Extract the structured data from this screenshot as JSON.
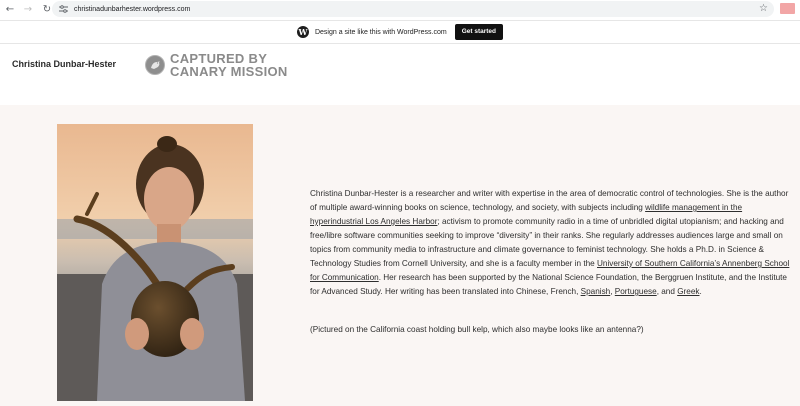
{
  "browser": {
    "url": "christinadunbarhester.wordpress.com",
    "back_icon": "arrow-left-icon",
    "forward_icon": "arrow-right-icon",
    "reload_icon": "reload-icon",
    "bookmark_icon": "star-icon"
  },
  "wp_banner": {
    "text": "Design a site like this with WordPress.com",
    "button_label": "Get started"
  },
  "header": {
    "site_title": "Christina Dunbar-Hester",
    "watermark_line1": "CAPTURED BY",
    "watermark_line2": "CANARY MISSION"
  },
  "bio": {
    "p1": "Christina Dunbar-Hester is a researcher and writer with expertise in the area of democratic control of technologies. She is the author of multiple award-winning books on science, technology, and society, with subjects including ",
    "link1": "wildlife management in the hyperindustrial Los Angeles Harbor",
    "p2": "; activism to promote community radio in a time of unbridled digital utopianism; and hacking and free/libre software communities seeking to improve “diversity” in their ranks. She regularly addresses audiences large and small on topics from community media to infrastructure and climate governance to feminist technology. She holds a Ph.D. in Science & Technology Studies from Cornell University, and she is a faculty member in the ",
    "link2": "University of Southern California’s Annenberg School for Communication",
    "p3": ". Her research has been supported by the National Science Foundation, the Berggruen Institute, and the Institute for Advanced Study. Her writing has been translated into Chinese, French, ",
    "link3": "Spanish",
    "sep1": ", ",
    "link4": "Portuguese",
    "sep2": ", and ",
    "link5": "Greek",
    "end": ".",
    "caption": "(Pictured on the California coast holding bull kelp, which also maybe looks like an antenna?)"
  },
  "colors": {
    "page_bg": "#faf6f4",
    "button_bg": "#111111",
    "watermark": "#8a8a8a"
  }
}
